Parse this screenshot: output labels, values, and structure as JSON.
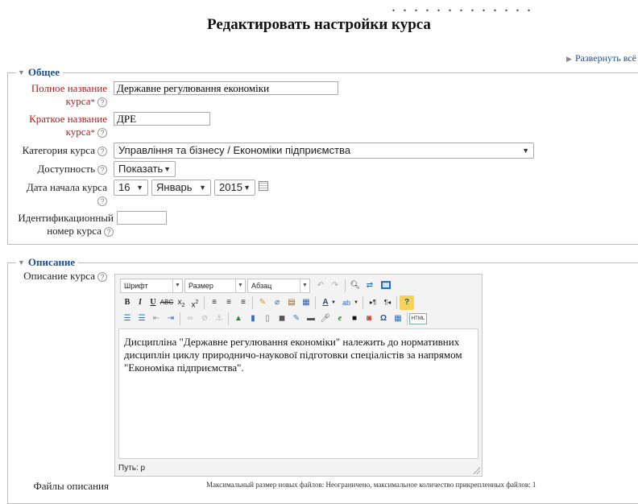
{
  "page": {
    "title": "Редактировать настройки курса",
    "expand_all": "Развернуть всё"
  },
  "general": {
    "legend": "Общее",
    "fullname_label_1": "Полное название",
    "fullname_label_2": "курса",
    "fullname_value": "Державне регулювання економіки",
    "shortname_label_1": "Краткое название",
    "shortname_label_2": "курса",
    "shortname_value": "ДРЕ",
    "category_label": "Категория курса",
    "category_value": "Управління та бізнесу / Економіки підприємства",
    "visibility_label": "Доступность",
    "visibility_value": "Показать",
    "startdate_label": "Дата начала курса",
    "start_day": "16",
    "start_month": "Январь",
    "start_year": "2015",
    "idnumber_label_1": "Идентификационный",
    "idnumber_label_2": "номер курса",
    "idnumber_value": ""
  },
  "description": {
    "legend": "Описание",
    "summary_label": "Описание курса",
    "toolbar": {
      "font": "Шрифт",
      "size": "Размер",
      "format": "Абзац",
      "help_glyph": "?",
      "html_label": "HTML"
    },
    "content": "Дисципліна \"Державне регулювання економіки\" належить до нормативних дисциплін циклу природничо-наукової підготовки спеціалістів за напрямом \"Економіка підприємства\".",
    "path": "Путь: p",
    "files_label": "Файлы описания",
    "files_info": "Максимальный размер новых файлов: Неограничено, максимальное количество прикрепленных файлов: 1"
  },
  "help_glyph": "?",
  "required_glyph": "*"
}
